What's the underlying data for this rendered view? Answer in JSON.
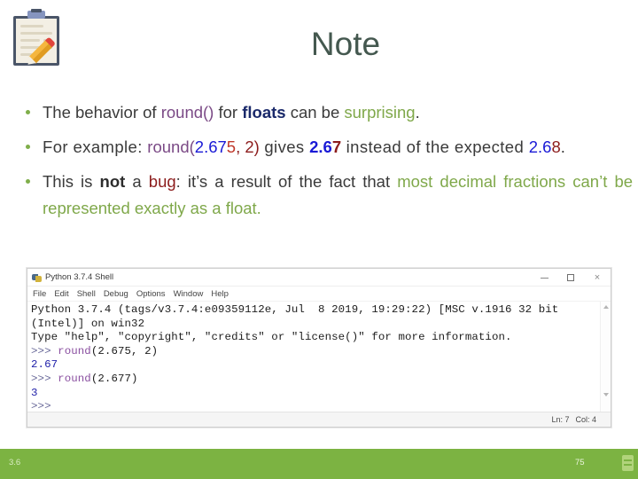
{
  "slide": {
    "title": "Note",
    "icon_name": "clipboard-pencil-icon",
    "accent_color": "#7cb342",
    "title_color": "#44584f"
  },
  "bullets": [
    {
      "id": "bullet-1",
      "full_text": "The behavior of round() for floats can be surprising.",
      "segments": [
        {
          "text": "The behavior of ",
          "style": "plain"
        },
        {
          "text": "round()",
          "style": "purple"
        },
        {
          "text": " for ",
          "style": "plain"
        },
        {
          "text": "floats",
          "style": "navy-bold"
        },
        {
          "text": " can be ",
          "style": "plain"
        },
        {
          "text": "surprising",
          "style": "green"
        },
        {
          "text": ".",
          "style": "plain"
        }
      ]
    },
    {
      "id": "bullet-2",
      "full_text": "For example: round(2.675, 2) gives 2.67 instead of the expected 2.68.",
      "segments": [
        {
          "text": "For  example:  ",
          "style": "plain"
        },
        {
          "text": "round(",
          "style": "purple"
        },
        {
          "text": "2.67",
          "style": "blue"
        },
        {
          "text": "5",
          "style": "red"
        },
        {
          "text": ",  2)",
          "style": "dark-red"
        },
        {
          "text": "  gives  ",
          "style": "plain"
        },
        {
          "text": "2.6",
          "style": "blue-bold"
        },
        {
          "text": "7",
          "style": "dark-red-bold"
        },
        {
          "text": "  instead  of  the expected ",
          "style": "plain"
        },
        {
          "text": "2.6",
          "style": "blue"
        },
        {
          "text": "8",
          "style": "dark-red"
        },
        {
          "text": ".",
          "style": "plain"
        }
      ]
    },
    {
      "id": "bullet-3",
      "full_text": "This is not a bug: it's a result of the fact that most decimal fractions can't be represented exactly as a float.",
      "segments": [
        {
          "text": "This is ",
          "style": "plain"
        },
        {
          "text": "not",
          "style": "bold"
        },
        {
          "text": " a ",
          "style": "plain"
        },
        {
          "text": "bug",
          "style": "dark-red"
        },
        {
          "text": ": it’s a result of the fact that ",
          "style": "plain"
        },
        {
          "text": "most decimal fractions can’t be represented exactly as a float",
          "style": "green"
        },
        {
          "text": ".",
          "style": "plain"
        }
      ]
    }
  ],
  "shell": {
    "window_title": "Python 3.7.4 Shell",
    "app_icon": "python-idle-icon",
    "menu": [
      "File",
      "Edit",
      "Shell",
      "Debug",
      "Options",
      "Window",
      "Help"
    ],
    "window_buttons": {
      "minimize": "minimize-button",
      "maximize": "maximize-button",
      "close": "×"
    },
    "console_lines": [
      {
        "kind": "banner",
        "text": "Python 3.7.4 (tags/v3.7.4:e09359112e, Jul  8 2019, 19:29:22) [MSC v.1916 32 bit"
      },
      {
        "kind": "banner",
        "text": "(Intel)] on win32"
      },
      {
        "kind": "banner",
        "text": "Type \"help\", \"copyright\", \"credits\" or \"license()\" for more information."
      },
      {
        "kind": "input",
        "prompt": ">>> ",
        "func": "round",
        "args": "(2.675, 2)"
      },
      {
        "kind": "output",
        "text": "2.67"
      },
      {
        "kind": "input",
        "prompt": ">>> ",
        "func": "round",
        "args": "(2.677)"
      },
      {
        "kind": "output",
        "text": "3"
      },
      {
        "kind": "prompt",
        "text": ">>>"
      }
    ],
    "status": {
      "line_label": "Ln: 7",
      "col_label": "Col: 4"
    }
  },
  "footer": {
    "left_label": "3.6",
    "page_number": "75",
    "icon_name": "notes-icon"
  }
}
